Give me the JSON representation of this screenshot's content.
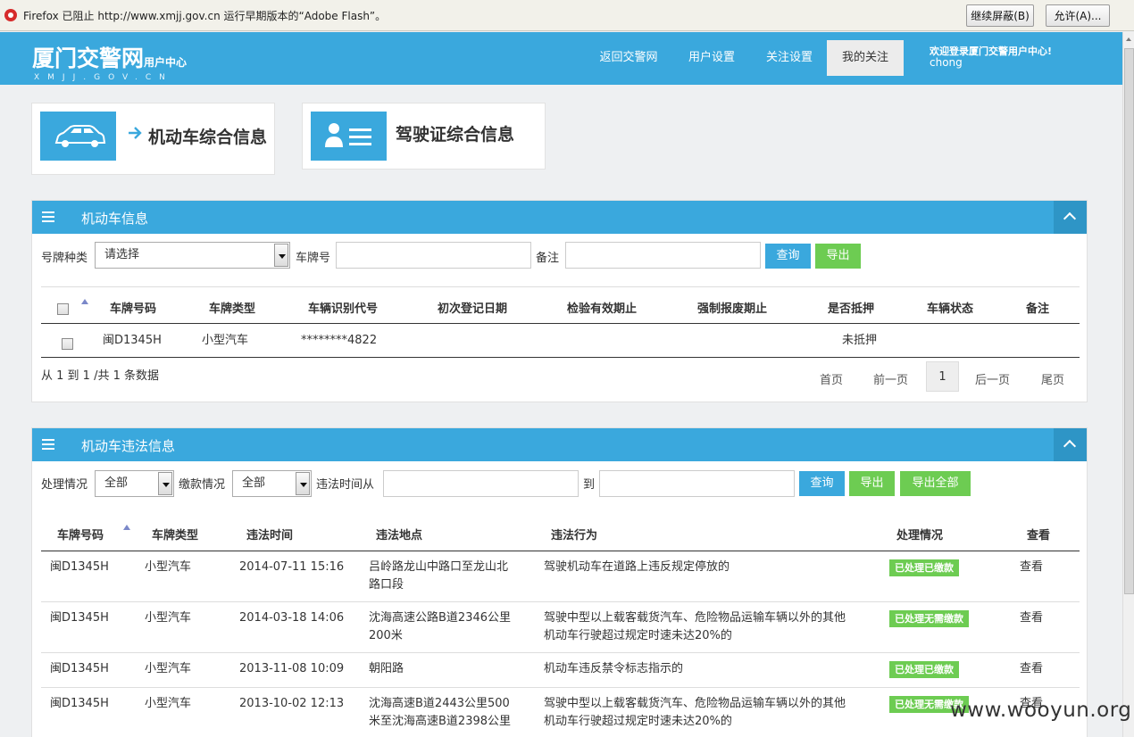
{
  "flash_bar": {
    "message": "Firefox 已阻止 http://www.xmjj.gov.cn 运行早期版本的“Adobe Flash”。",
    "continue_block_label": "继续屏蔽(B)",
    "allow_label": "允许(A)..."
  },
  "header": {
    "logo_main": "厦门交警网",
    "logo_suffix": "用户中心",
    "logo_domain": "XMJJ.GOV.CN",
    "nav": [
      "返回交警网",
      "用户设置",
      "关注设置",
      "我的关注"
    ],
    "welcome_text": "欢迎登录厦门交警用户中心!",
    "username": "chong"
  },
  "cards": {
    "vehicle_title": "机动车综合信息",
    "license_title": "驾驶证综合信息"
  },
  "vehicle_panel": {
    "title": "机动车信息",
    "filter": {
      "plate_type_label": "号牌种类",
      "plate_type_value": "请选择",
      "plate_no_label": "车牌号",
      "remark_label": "备注",
      "query_label": "查询",
      "export_label": "导出"
    },
    "columns": [
      "车牌号码",
      "车牌类型",
      "车辆识别代号",
      "初次登记日期",
      "检验有效期止",
      "强制报废期止",
      "是否抵押",
      "车辆状态",
      "备注"
    ],
    "rows": [
      {
        "plate": "闽D1345H",
        "type": "小型汽车",
        "vin": "********4822",
        "first_reg": "",
        "inspect": "",
        "scrap": "",
        "mortgage": "未抵押",
        "status": "",
        "remark": ""
      }
    ],
    "summary": "从 1 到 1 /共 1 条数据",
    "pager": {
      "first": "首页",
      "prev": "前一页",
      "current": "1",
      "next": "后一页",
      "last": "尾页"
    }
  },
  "violation_panel": {
    "title": "机动车违法信息",
    "filter": {
      "handle_label": "处理情况",
      "handle_value": "全部",
      "fine_label": "缴款情况",
      "fine_value": "全部",
      "time_from_label": "违法时间从",
      "time_to_label": "到",
      "query_label": "查询",
      "export_label": "导出",
      "export_all_label": "导出全部"
    },
    "columns": [
      "车牌号码",
      "车牌类型",
      "违法时间",
      "违法地点",
      "违法行为",
      "处理情况",
      "查看"
    ],
    "rows": [
      {
        "plate": "闽D1345H",
        "type": "小型汽车",
        "time": "2014-07-11 15:16",
        "place_1": "吕岭路龙山中路口至龙山北",
        "place_2": "路口段",
        "act_1": "驾驶机动车在道路上违反规定停放的",
        "act_2": "",
        "status": "已处理已缴款",
        "view": "查看"
      },
      {
        "plate": "闽D1345H",
        "type": "小型汽车",
        "time": "2014-03-18 14:06",
        "place_1": "沈海高速公路B道2346公里",
        "place_2": "200米",
        "act_1": "驾驶中型以上载客载货汽车、危险物品运输车辆以外的其他",
        "act_2": "机动车行驶超过规定时速未达20%的",
        "status": "已处理无需缴款",
        "view": "查看"
      },
      {
        "plate": "闽D1345H",
        "type": "小型汽车",
        "time": "2013-11-08 10:09",
        "place_1": "朝阳路",
        "place_2": "",
        "act_1": "机动车违反禁令标志指示的",
        "act_2": "",
        "status": "已处理已缴款",
        "view": "查看"
      },
      {
        "plate": "闽D1345H",
        "type": "小型汽车",
        "time": "2013-10-02 12:13",
        "place_1": "沈海高速B道2443公里500",
        "place_2": "米至沈海高速B道2398公里",
        "act_1": "驾驶中型以上载客载货汽车、危险物品运输车辆以外的其他",
        "act_2": "机动车行驶超过规定时速未达20%的",
        "status": "已处理无需缴款",
        "view": "查看"
      }
    ]
  },
  "watermark": "www.wooyun.org"
}
